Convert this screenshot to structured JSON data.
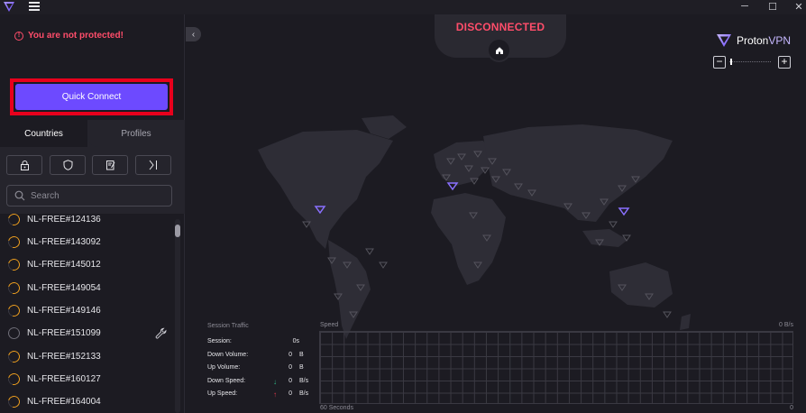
{
  "window": {
    "minimize": "─",
    "maximize": "☐",
    "close": "✕"
  },
  "warning": {
    "text": "You are not protected!",
    "icon": "exclamation-circle-icon",
    "color": "#ff4d6a"
  },
  "quick_connect": {
    "label": "Quick Connect",
    "color": "#6d4aff"
  },
  "tabs": [
    {
      "label": "Countries",
      "active": true
    },
    {
      "label": "Profiles",
      "active": false
    }
  ],
  "filters": [
    {
      "icon": "lock-icon"
    },
    {
      "icon": "shield-icon"
    },
    {
      "icon": "notepad-icon"
    },
    {
      "icon": "split-tunnel-icon"
    }
  ],
  "search": {
    "placeholder": "Search"
  },
  "servers": [
    {
      "name": "NL-FREE#124136",
      "status": "load"
    },
    {
      "name": "NL-FREE#143092",
      "status": "load"
    },
    {
      "name": "NL-FREE#145012",
      "status": "load"
    },
    {
      "name": "NL-FREE#149054",
      "status": "load"
    },
    {
      "name": "NL-FREE#149146",
      "status": "load"
    },
    {
      "name": "NL-FREE#151099",
      "status": "maintenance"
    },
    {
      "name": "NL-FREE#152133",
      "status": "load"
    },
    {
      "name": "NL-FREE#160127",
      "status": "load"
    },
    {
      "name": "NL-FREE#164004",
      "status": "load"
    }
  ],
  "map": {
    "status": "DISCONNECTED",
    "status_color": "#ff4d6a",
    "brand_part1": "Proton",
    "brand_part2": "VPN",
    "zoom_out": "−",
    "zoom_in": "+"
  },
  "traffic": {
    "title": "Session Traffic",
    "rows": [
      {
        "label": "Session:",
        "value": "0s",
        "unit": ""
      },
      {
        "label": "Down Volume:",
        "value": "0",
        "unit": "B"
      },
      {
        "label": "Up Volume:",
        "value": "0",
        "unit": "B"
      },
      {
        "label": "Down Speed:",
        "value": "0",
        "unit": "B/s",
        "arrow": "↓"
      },
      {
        "label": "Up Speed:",
        "value": "0",
        "unit": "B/s",
        "arrow": "↑"
      }
    ],
    "speed_label": "Speed",
    "speed_max": "0 B/s",
    "axis_left": "60 Seconds",
    "axis_right": "0"
  }
}
